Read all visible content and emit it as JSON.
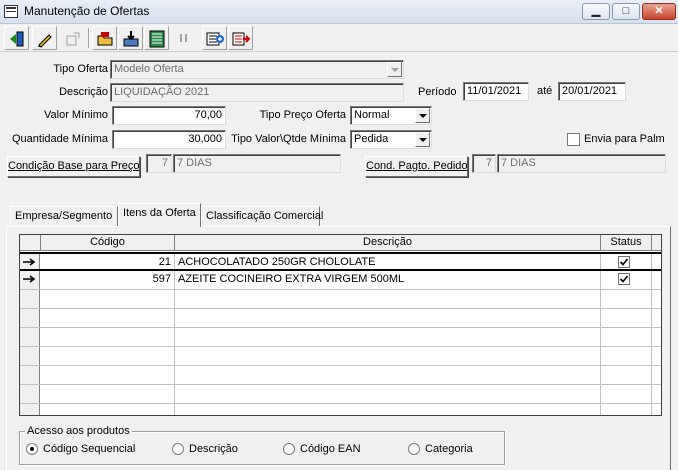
{
  "window": {
    "title": "Manutenção de Ofertas"
  },
  "toolbar": {
    "buttons": [
      "exit-icon",
      "edit-icon",
      "disabled-icon",
      "open-folder-icon",
      "save-icon",
      "list-icon",
      "disabled-quote-icon",
      "add-item-icon",
      "remove-item-icon"
    ]
  },
  "form": {
    "tipo_oferta": {
      "label": "Tipo Oferta",
      "value": "Modelo Oferta"
    },
    "descricao": {
      "label": "Descrição",
      "value": "LIQUIDAÇÃO 2021"
    },
    "periodo": {
      "label": "Período",
      "start": "11/01/2021",
      "sep_label": "até",
      "end": "20/01/2021"
    },
    "valor_minimo": {
      "label": "Valor Mínimo",
      "value": "70,00"
    },
    "tipo_preco_oferta": {
      "label": "Tipo Preço Oferta",
      "value": "Normal"
    },
    "quantidade_minima": {
      "label": "Quantidade Mínima",
      "value": "30,000"
    },
    "tipo_valor_qtde": {
      "label": "Tipo Valor\\Qtde Mínima",
      "value": "Pedida"
    },
    "envia_palm": {
      "label": "Envia para Palm",
      "checked": false
    },
    "condicao_base": {
      "button": "Condição Base para Preço",
      "code": "7",
      "desc": "7 DIAS"
    },
    "cond_pagto": {
      "button": "Cond. Pagto. Pedido",
      "code": "7",
      "desc": "7 DIAS"
    }
  },
  "tabs": [
    {
      "label": "Empresa/Segmento"
    },
    {
      "label": "Itens da Oferta"
    },
    {
      "label": "Classificação Comercial"
    }
  ],
  "grid": {
    "headers": {
      "code": "Código",
      "desc": "Descrição",
      "status": "Status"
    },
    "rows": [
      {
        "code": "21",
        "desc": "ACHOCOLATADO 250GR CHOLOLATE",
        "status": true,
        "current": true
      },
      {
        "code": "597",
        "desc": "AZEITE COCINEIRO EXTRA VIRGEM 500ML",
        "status": true,
        "current": false
      }
    ]
  },
  "acesso": {
    "title": "Acesso aos produtos",
    "options": [
      "Código Sequencial",
      "Descrição",
      "Código EAN",
      "Categoria"
    ],
    "selected": "Código Sequencial"
  }
}
